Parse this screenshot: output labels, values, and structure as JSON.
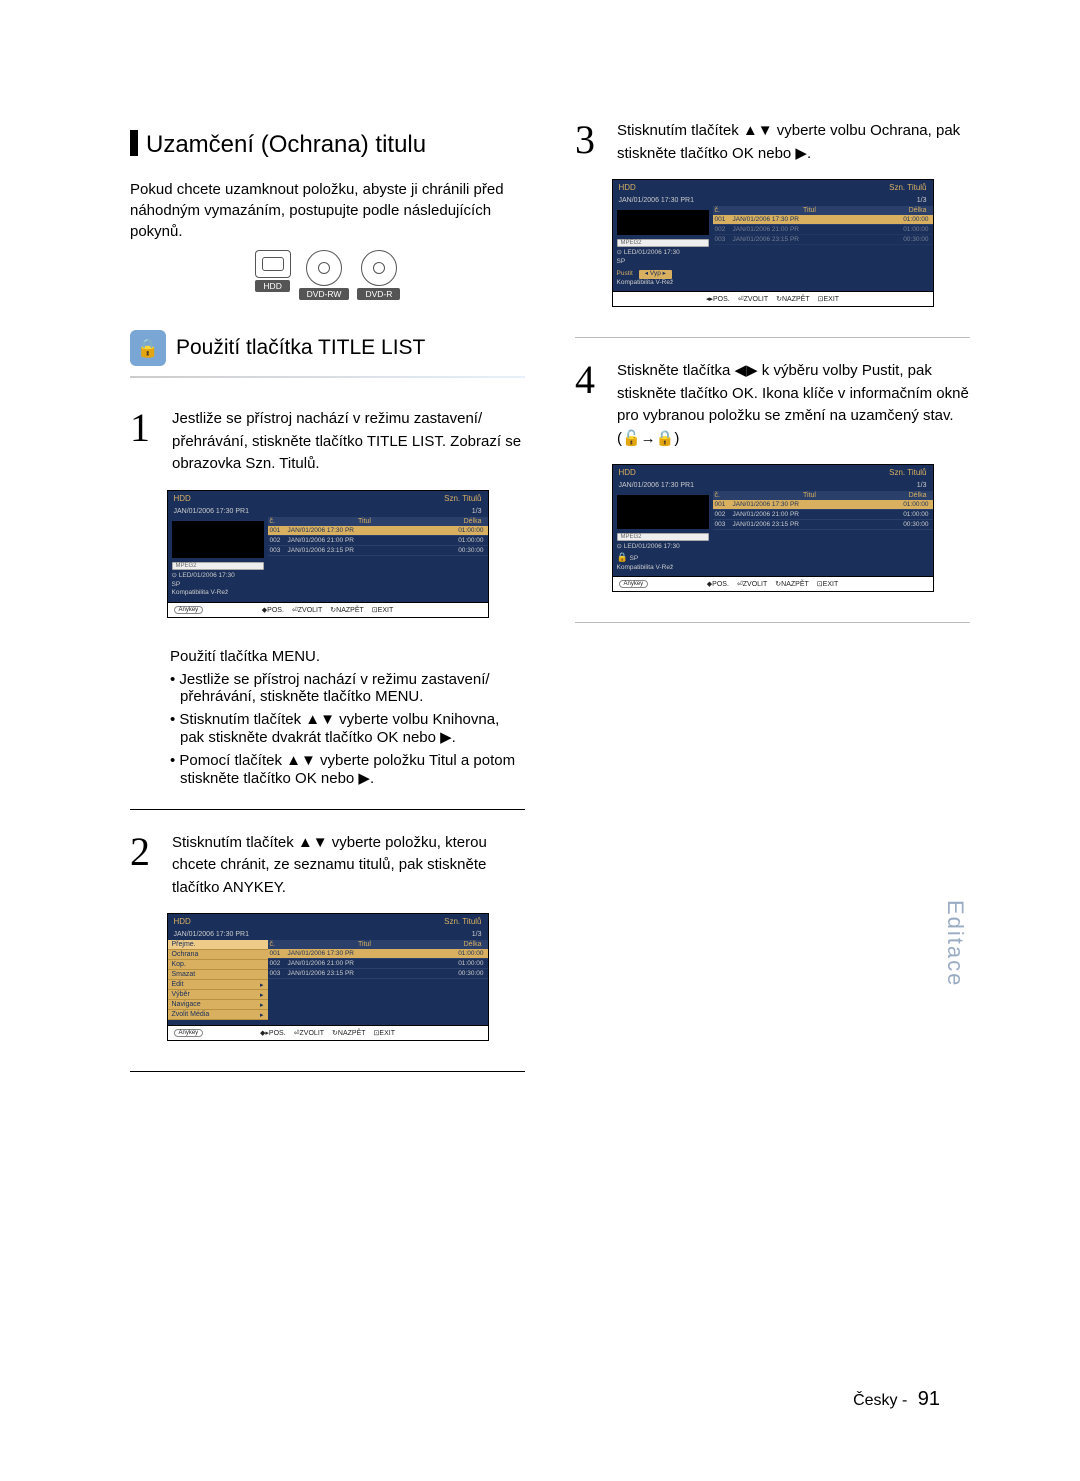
{
  "title": "Uzamčení (Ochrana) titulu",
  "intro": "Pokud chcete uzamknout položku, abyste ji chránili před náhodným vymazáním, postupujte podle následujících pokynů.",
  "disc_labels": {
    "hdd": "HDD",
    "dvdrw": "DVD-RW",
    "dvdr": "DVD-R"
  },
  "subsection": "Použití tlačítka TITLE LIST",
  "steps": {
    "s1": "Jestliže se přístroj nachází v režimu zastavení/ přehrávání, stiskněte tlačítko TITLE LIST. Zobrazí se obrazovka Szn. Titulů.",
    "s2": "Stisknutím tlačítek ▲▼ vyberte položku, kterou chcete chránit, ze seznamu titulů, pak stiskněte tlačítko ANYKEY.",
    "s3": "Stisknutím tlačítek ▲▼ vyberte volbu Ochrana, pak stiskněte tlačítko OK nebo ▶.",
    "s4": "Stiskněte tlačítka ◀▶ k výběru volby Pustit, pak stiskněte tlačítko OK. Ikona klíče v informačním okně pro vybranou položku se změní na uzamčený stav. (🔓→🔒)"
  },
  "menu_heading": "Použití tlačítka MENU.",
  "menu_bullets": {
    "b1": "Jestliže se přístroj nachází v režimu zastavení/ přehrávání, stiskněte tlačítko MENU.",
    "b2": "Stisknutím tlačítek ▲▼ vyberte volbu Knihovna, pak stiskněte dvakrát tlačítko OK nebo ▶.",
    "b3": "Pomocí tlačítek ▲▼ vyberte položku Titul a potom stiskněte tlačítko OK nebo ▶."
  },
  "osd": {
    "media": "HDD",
    "list_title": "Szn. Titulů",
    "breadcrumb": "JAN/01/2006 17:30 PR1",
    "counter": "1/3",
    "cols": {
      "num": "č.",
      "title": "Titul",
      "len": "Délka"
    },
    "rows": [
      {
        "n": "001",
        "t": "JAN/01/2006 17:30 PR",
        "d": "01:00:00"
      },
      {
        "n": "002",
        "t": "JAN/01/2006 21:00 PR",
        "d": "01:00:00"
      },
      {
        "n": "003",
        "t": "JAN/01/2006 23:15 PR",
        "d": "00:30:00"
      }
    ],
    "meta1": "LED/01/2006 17:30",
    "meta2": "SP",
    "meta3": "Kompatibilita V-Rež",
    "mpeg": "MPEG2",
    "protect_label": "Pustit",
    "protect_value": "Vyp",
    "footer": {
      "anykey": "Anykey",
      "pos": "POS.",
      "sel": "ZVOLIT",
      "ret": "NAZPĚT",
      "exit": "EXIT"
    },
    "popup": {
      "i1": "Přejme.",
      "i2": "Ochrana",
      "i3": "Kop.",
      "i4": "Smazat",
      "i5": "Edit",
      "i6": "Výběr",
      "i7": "Navigace",
      "i8": "Zvolit Média"
    }
  },
  "side_tab": "Editace",
  "page_lang": "Česky -",
  "page_num": "91"
}
